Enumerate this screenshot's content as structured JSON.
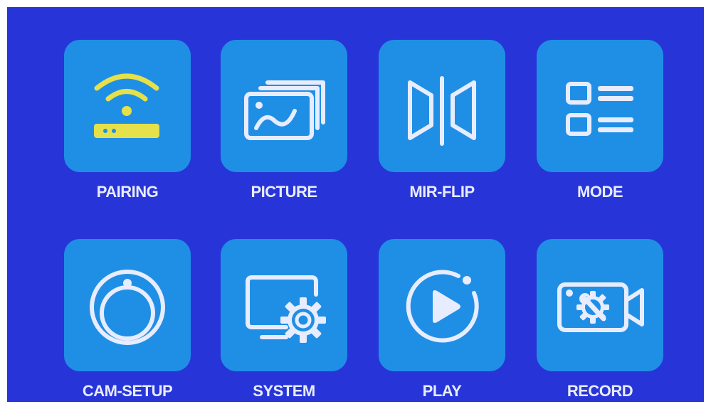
{
  "theme": {
    "background": "#2735d8",
    "tile": "#1f8fe6",
    "icon": "#e8ecff",
    "accent": "#e6e04a"
  },
  "menu": {
    "items": [
      {
        "label": "PAIRING",
        "icon": "wifi-router-icon"
      },
      {
        "label": "PICTURE",
        "icon": "picture-icon"
      },
      {
        "label": "MIR-FLIP",
        "icon": "mirror-flip-icon"
      },
      {
        "label": "MODE",
        "icon": "mode-list-icon"
      },
      {
        "label": "CAM-SETUP",
        "icon": "camera-lens-icon"
      },
      {
        "label": "SYSTEM",
        "icon": "system-settings-icon"
      },
      {
        "label": "PLAY",
        "icon": "play-icon"
      },
      {
        "label": "RECORD",
        "icon": "record-settings-icon"
      }
    ]
  }
}
